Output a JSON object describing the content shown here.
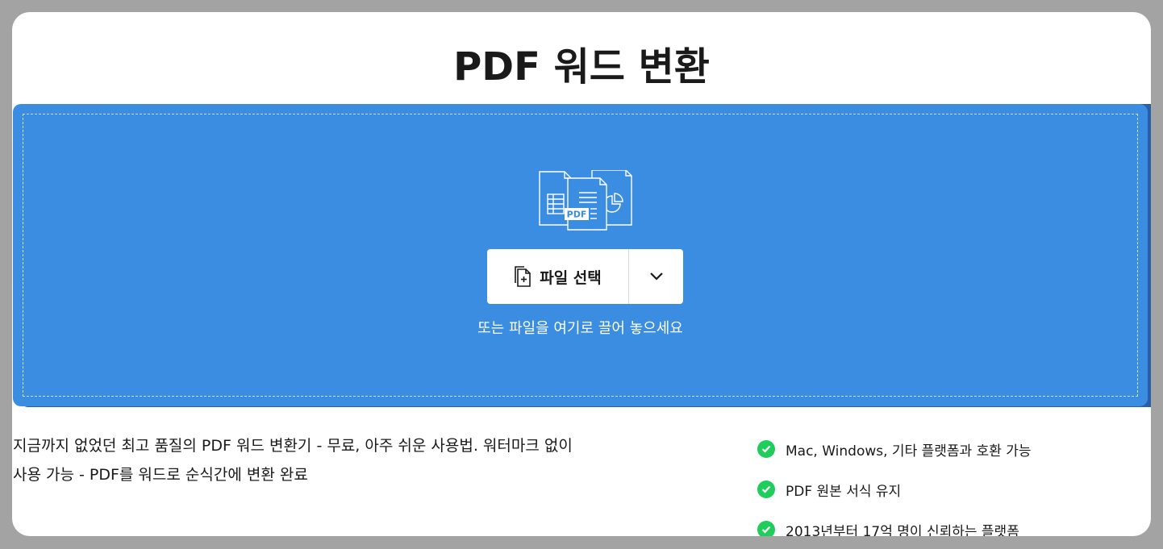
{
  "page": {
    "title": "PDF 워드 변환"
  },
  "dropzone": {
    "select_button_label": "파일 선택",
    "hint": "또는 파일을 여기로 끌어 놓으세요",
    "icon_pdf_label": "PDF",
    "colors": {
      "background": "#3a8de0",
      "shadow": "#2a5ea8"
    }
  },
  "description": {
    "line1": "지금까지 없었던 최고 품질의 PDF 워드 변환기 - 무료, 아주 쉬운 사용법. 워터마크 없이",
    "line2": "사용 가능 - PDF를 워드로 순식간에 변환 완료"
  },
  "features": [
    {
      "text": "Mac, Windows, 기타 플랫폼과 호환 가능",
      "icon": "check-circle-icon"
    },
    {
      "text": "PDF 원본 서식 유지",
      "icon": "check-circle-icon"
    },
    {
      "text": "2013년부터 17억 명이 신뢰하는 플랫폼",
      "icon": "check-circle-icon"
    }
  ],
  "colors": {
    "check": "#1fcd5b"
  }
}
